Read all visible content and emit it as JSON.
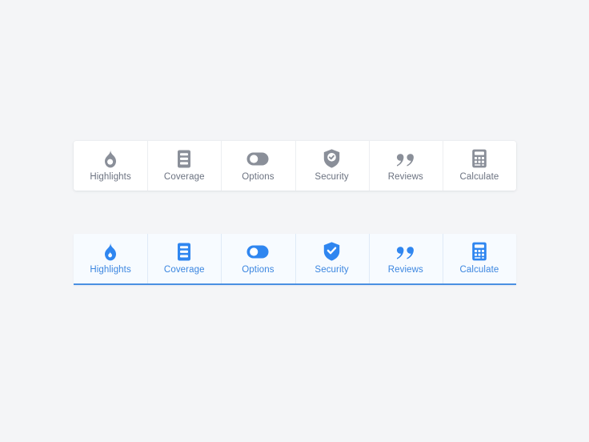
{
  "page": {
    "background_color": "#f4f5f7"
  },
  "tabbars": [
    {
      "id": "tabbar-default",
      "state_label": "default",
      "icon_color": "#8a8f99",
      "label_color": "#6b7280",
      "background_color": "#ffffff",
      "divider_color": "#eceef1",
      "items": [
        {
          "icon": "flame-icon",
          "label": "Highlights"
        },
        {
          "icon": "document-icon",
          "label": "Coverage"
        },
        {
          "icon": "toggle-icon",
          "label": "Options"
        },
        {
          "icon": "shield-check-icon",
          "label": "Security"
        },
        {
          "icon": "quote-icon",
          "label": "Reviews"
        },
        {
          "icon": "calculator-icon",
          "label": "Calculate"
        }
      ]
    },
    {
      "id": "tabbar-active",
      "state_label": "active",
      "icon_color": "#2f86f0",
      "label_color": "#3b86e0",
      "background_color": "#f7fbff",
      "divider_color": "#dfeaf7",
      "underline_color": "#4a90e2",
      "items": [
        {
          "icon": "flame-icon",
          "label": "Highlights"
        },
        {
          "icon": "document-icon",
          "label": "Coverage"
        },
        {
          "icon": "toggle-icon",
          "label": "Options"
        },
        {
          "icon": "shield-check-icon",
          "label": "Security"
        },
        {
          "icon": "quote-icon",
          "label": "Reviews"
        },
        {
          "icon": "calculator-icon",
          "label": "Calculate"
        }
      ]
    }
  ]
}
